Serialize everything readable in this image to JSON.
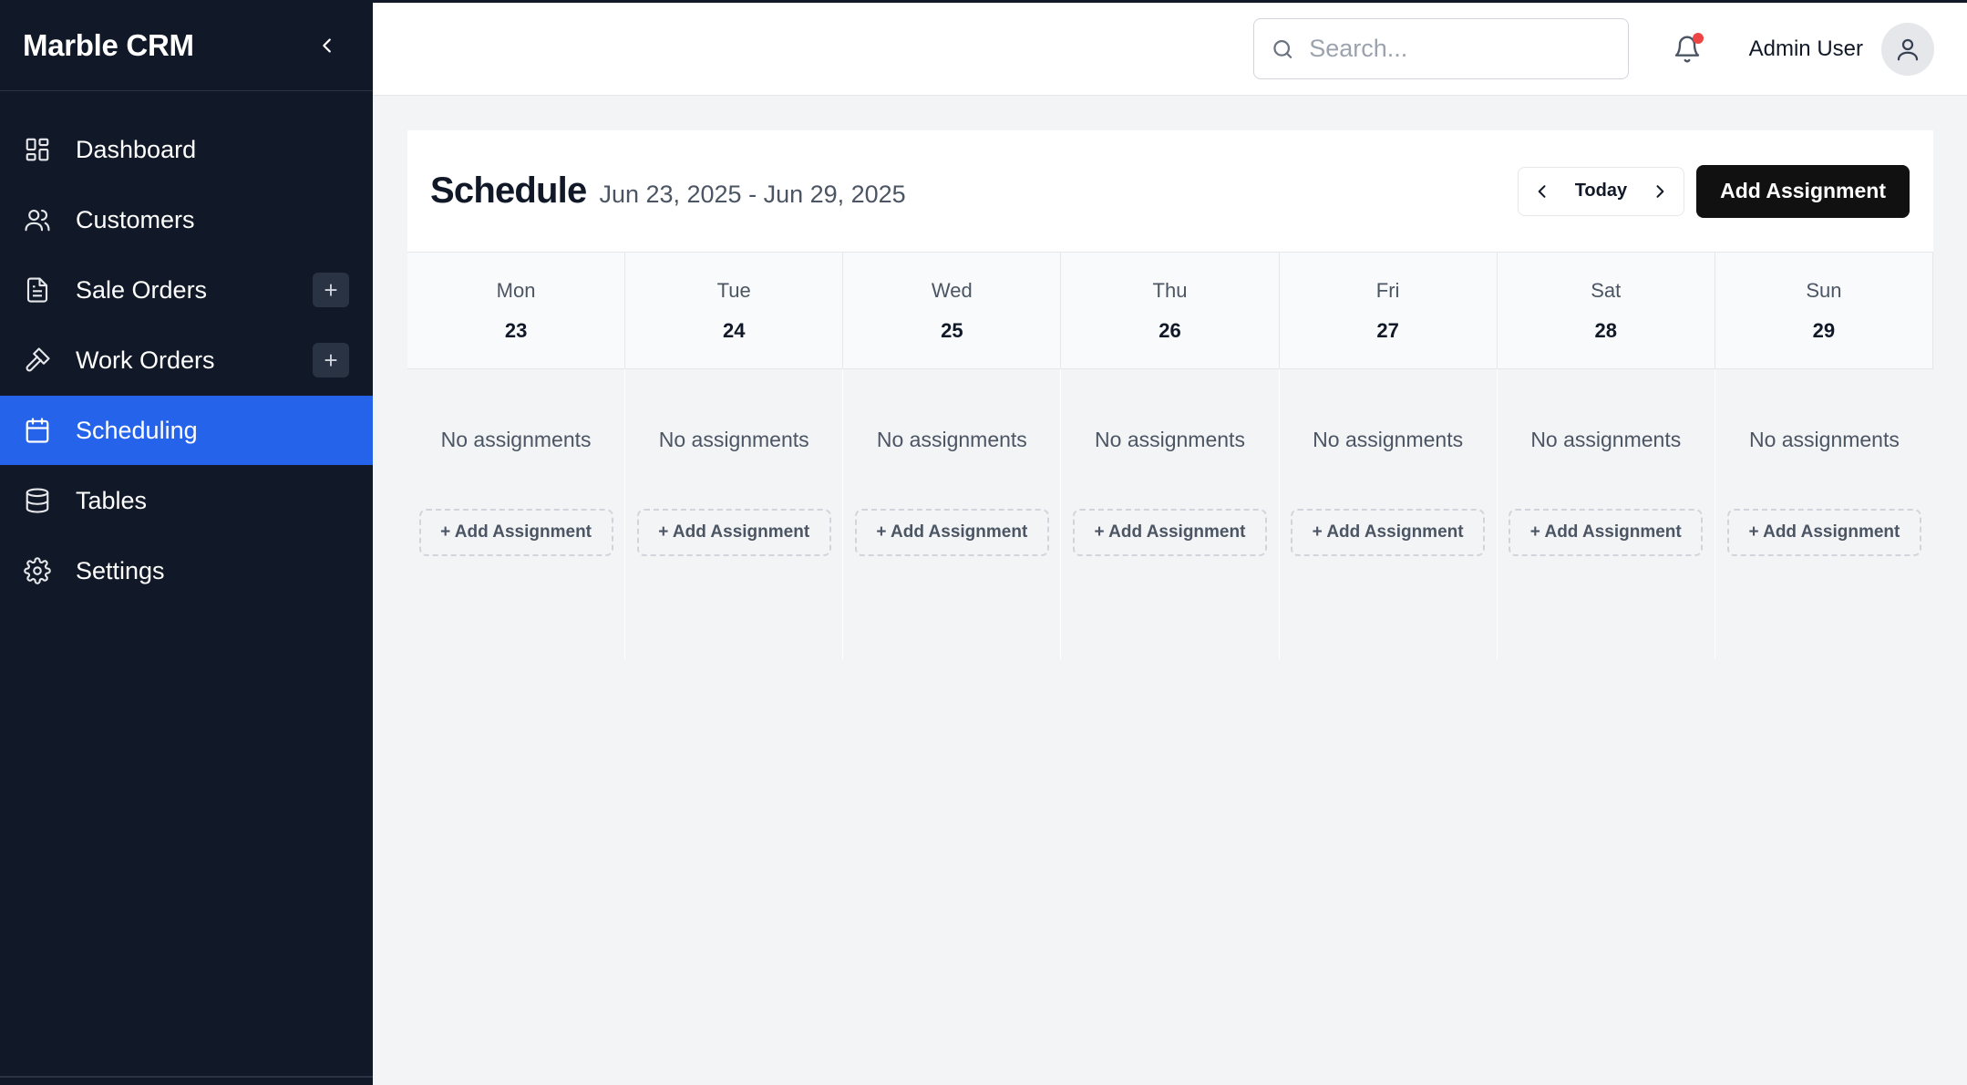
{
  "brand": "Marble CRM",
  "sidebar": {
    "items": [
      {
        "label": "Dashboard",
        "icon": "dashboard-icon"
      },
      {
        "label": "Customers",
        "icon": "users-icon"
      },
      {
        "label": "Sale Orders",
        "icon": "document-icon",
        "has_add": true
      },
      {
        "label": "Work Orders",
        "icon": "hammer-icon",
        "has_add": true
      },
      {
        "label": "Scheduling",
        "icon": "calendar-icon",
        "active": true
      },
      {
        "label": "Tables",
        "icon": "database-icon"
      },
      {
        "label": "Settings",
        "icon": "gear-icon"
      }
    ],
    "add_symbol": "+"
  },
  "topbar": {
    "search_placeholder": "Search...",
    "user_name": "Admin User",
    "has_notification": true
  },
  "schedule": {
    "title": "Schedule",
    "date_range": "Jun 23, 2025 - Jun 29, 2025",
    "today_label": "Today",
    "add_button_label": "Add Assignment",
    "days": [
      {
        "name": "Mon",
        "num": "23",
        "empty_text": "No assignments",
        "add_label": "+ Add Assignment"
      },
      {
        "name": "Tue",
        "num": "24",
        "empty_text": "No assignments",
        "add_label": "+ Add Assignment"
      },
      {
        "name": "Wed",
        "num": "25",
        "empty_text": "No assignments",
        "add_label": "+ Add Assignment"
      },
      {
        "name": "Thu",
        "num": "26",
        "empty_text": "No assignments",
        "add_label": "+ Add Assignment"
      },
      {
        "name": "Fri",
        "num": "27",
        "empty_text": "No assignments",
        "add_label": "+ Add Assignment"
      },
      {
        "name": "Sat",
        "num": "28",
        "empty_text": "No assignments",
        "add_label": "+ Add Assignment"
      },
      {
        "name": "Sun",
        "num": "29",
        "empty_text": "No assignments",
        "add_label": "+ Add Assignment"
      }
    ]
  },
  "colors": {
    "sidebar_bg": "#111827",
    "active": "#2563eb",
    "notification": "#ef4444",
    "primary_button": "#111111"
  }
}
